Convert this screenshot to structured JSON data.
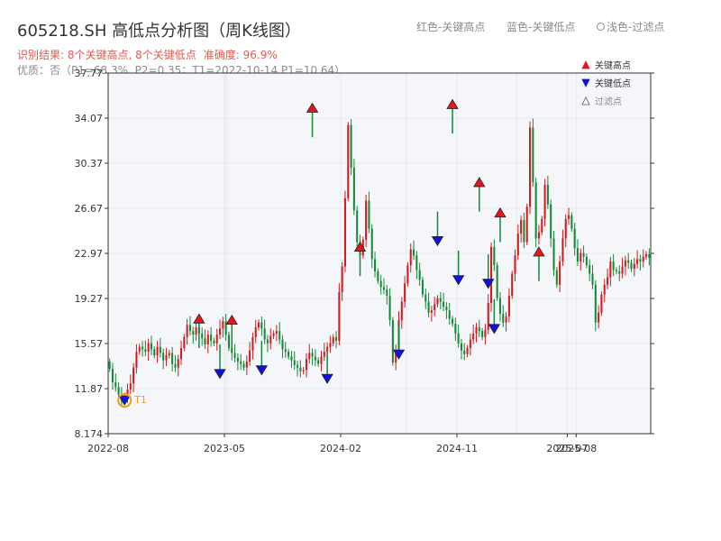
{
  "header": {
    "title": "605218.SH 高低点分析图（周K线图）",
    "legend_red": "红色-关键高点",
    "legend_blue": "蓝色-关键低点",
    "legend_light": "浅色-过滤点",
    "result": "识别结果: 8个关键高点, 8个关键低点",
    "accuracy": "准确度: 96.9%",
    "optim": "优质：否（P1=68.3%, P2=0.35；T1=2022-10-14 P1=10.64）"
  },
  "colors": {
    "up": "#d7191c",
    "down": "#138a36",
    "high_marker": "#e8141c",
    "low_marker": "#1111dd",
    "t1": "#f39c12",
    "axis": "#333333",
    "grid": "#e6e9ef",
    "plot_bg": "#f5f6fa"
  },
  "chart_data": {
    "type": "candlestick",
    "title": "605218.SH 高低点分析图（周K线图）",
    "y_ticks": [
      "8.174",
      "11.87",
      "15.57",
      "19.27",
      "22.97",
      "26.67",
      "30.37",
      "34.07",
      "37.77"
    ],
    "ylim": [
      8.174,
      37.77
    ],
    "x_ticks": [
      {
        "label": "2022-08",
        "week": 0
      },
      {
        "label": "2023-05",
        "week": 39
      },
      {
        "label": "2024-02",
        "week": 78
      },
      {
        "label": "2024-11",
        "week": 117
      },
      {
        "label": "2025-07",
        "week": 154
      },
      {
        "label": "2025-08",
        "week": 157
      }
    ],
    "grid": true,
    "legend": {
      "position": "top-right",
      "entries": [
        {
          "label": "关键高点",
          "marker": "triangle-up",
          "color": "#e8141c"
        },
        {
          "label": "关键低点",
          "marker": "triangle-down",
          "color": "#1111dd"
        },
        {
          "label": "过滤点",
          "marker": "triangle-up-hollow",
          "color": "#555555"
        }
      ]
    },
    "closes": [
      13.5,
      12.4,
      12.0,
      11.4,
      10.9,
      11.3,
      11.8,
      12.3,
      13.6,
      14.9,
      15.3,
      15.1,
      14.9,
      15.6,
      15.1,
      14.6,
      15.3,
      14.8,
      14.2,
      14.6,
      14.8,
      13.9,
      13.6,
      14.3,
      15.2,
      16.1,
      17.1,
      16.6,
      16.3,
      16.9,
      16.4,
      16.0,
      15.5,
      16.3,
      15.8,
      15.6,
      16.3,
      16.8,
      17.4,
      16.3,
      15.2,
      14.8,
      14.4,
      14.1,
      13.9,
      13.6,
      14.1,
      15.0,
      16.1,
      16.9,
      17.3,
      16.8,
      15.9,
      15.6,
      16.2,
      16.4,
      16.6,
      15.9,
      15.1,
      14.9,
      14.5,
      14.2,
      13.8,
      13.6,
      13.3,
      13.4,
      14.3,
      14.8,
      14.5,
      14.2,
      13.9,
      14.5,
      14.9,
      15.3,
      15.6,
      16.1,
      15.8,
      19.8,
      21.9,
      27.5,
      33.5,
      30.0,
      26.5,
      23.9,
      22.8,
      24.1,
      27.3,
      25.0,
      22.5,
      21.5,
      20.7,
      20.2,
      20.0,
      19.5,
      17.5,
      14.0,
      15.0,
      17.5,
      19.0,
      20.5,
      22.0,
      23.3,
      22.8,
      21.6,
      20.8,
      19.6,
      19.0,
      18.1,
      18.3,
      18.8,
      19.3,
      19.0,
      18.6,
      18.3,
      17.6,
      17.2,
      16.4,
      15.6,
      15.0,
      14.7,
      15.2,
      15.9,
      16.4,
      16.9,
      16.6,
      16.1,
      16.7,
      18.9,
      23.5,
      22.0,
      19.3,
      18.0,
      17.3,
      17.8,
      19.5,
      21.3,
      22.8,
      24.6,
      25.7,
      23.9,
      26.8,
      33.3,
      28.8,
      24.2,
      24.7,
      25.8,
      28.6,
      27.0,
      24.2,
      21.6,
      20.4,
      22.3,
      24.2,
      25.8,
      26.1,
      25.0,
      23.4,
      22.3,
      23.0,
      22.7,
      22.0,
      21.3,
      20.4,
      17.3,
      18.1,
      19.6,
      20.4,
      21.0,
      22.3,
      21.6,
      21.5,
      21.3,
      21.9,
      22.4,
      22.2,
      21.7,
      22.1,
      22.5,
      22.3,
      22.7,
      22.9,
      22.6
    ],
    "key_highs": [
      {
        "week": 30,
        "value": 17.4
      },
      {
        "week": 41,
        "value": 17.3
      },
      {
        "week": 68,
        "value": 34.7
      },
      {
        "week": 84,
        "value": 23.3
      },
      {
        "week": 115,
        "value": 35.0
      },
      {
        "week": 124,
        "value": 28.6
      },
      {
        "week": 131,
        "value": 26.1
      },
      {
        "week": 144,
        "value": 22.9
      }
    ],
    "key_lows": [
      {
        "week": 37,
        "value": 13.3
      },
      {
        "week": 51,
        "value": 13.6
      },
      {
        "week": 73,
        "value": 12.9
      },
      {
        "week": 97,
        "value": 14.9
      },
      {
        "week": 110,
        "value": 24.2
      },
      {
        "week": 117,
        "value": 21.0
      },
      {
        "week": 127,
        "value": 20.7
      },
      {
        "week": 129,
        "value": 17.0
      }
    ],
    "annotations": [
      {
        "label": "T1",
        "week": 5,
        "value": 10.9
      }
    ]
  }
}
